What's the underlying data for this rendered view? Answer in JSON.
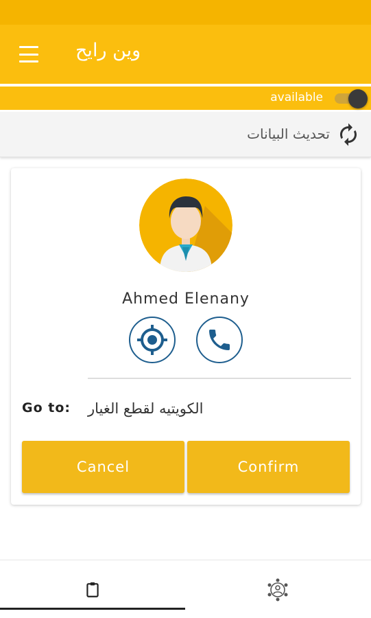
{
  "app": {
    "title": "وين رايح"
  },
  "status": {
    "available_label": "available",
    "available_on": true
  },
  "refresh": {
    "label": "تحديث البيانات"
  },
  "driver": {
    "name": "Ahmed Elenany"
  },
  "trip": {
    "goto_label": "Go to:",
    "destination": "الكويتيه لقطع الغيار"
  },
  "actions": {
    "cancel_label": "Cancel",
    "confirm_label": "Confirm"
  },
  "nav": {
    "tabs": [
      {
        "icon": "clipboard-icon",
        "active": true
      },
      {
        "icon": "network-icon",
        "active": false
      }
    ]
  },
  "colors": {
    "primary": "#FBBE0E",
    "status_bar": "#F5B400",
    "button": "#F2B91A",
    "icon_blue": "#1E5E8E"
  }
}
